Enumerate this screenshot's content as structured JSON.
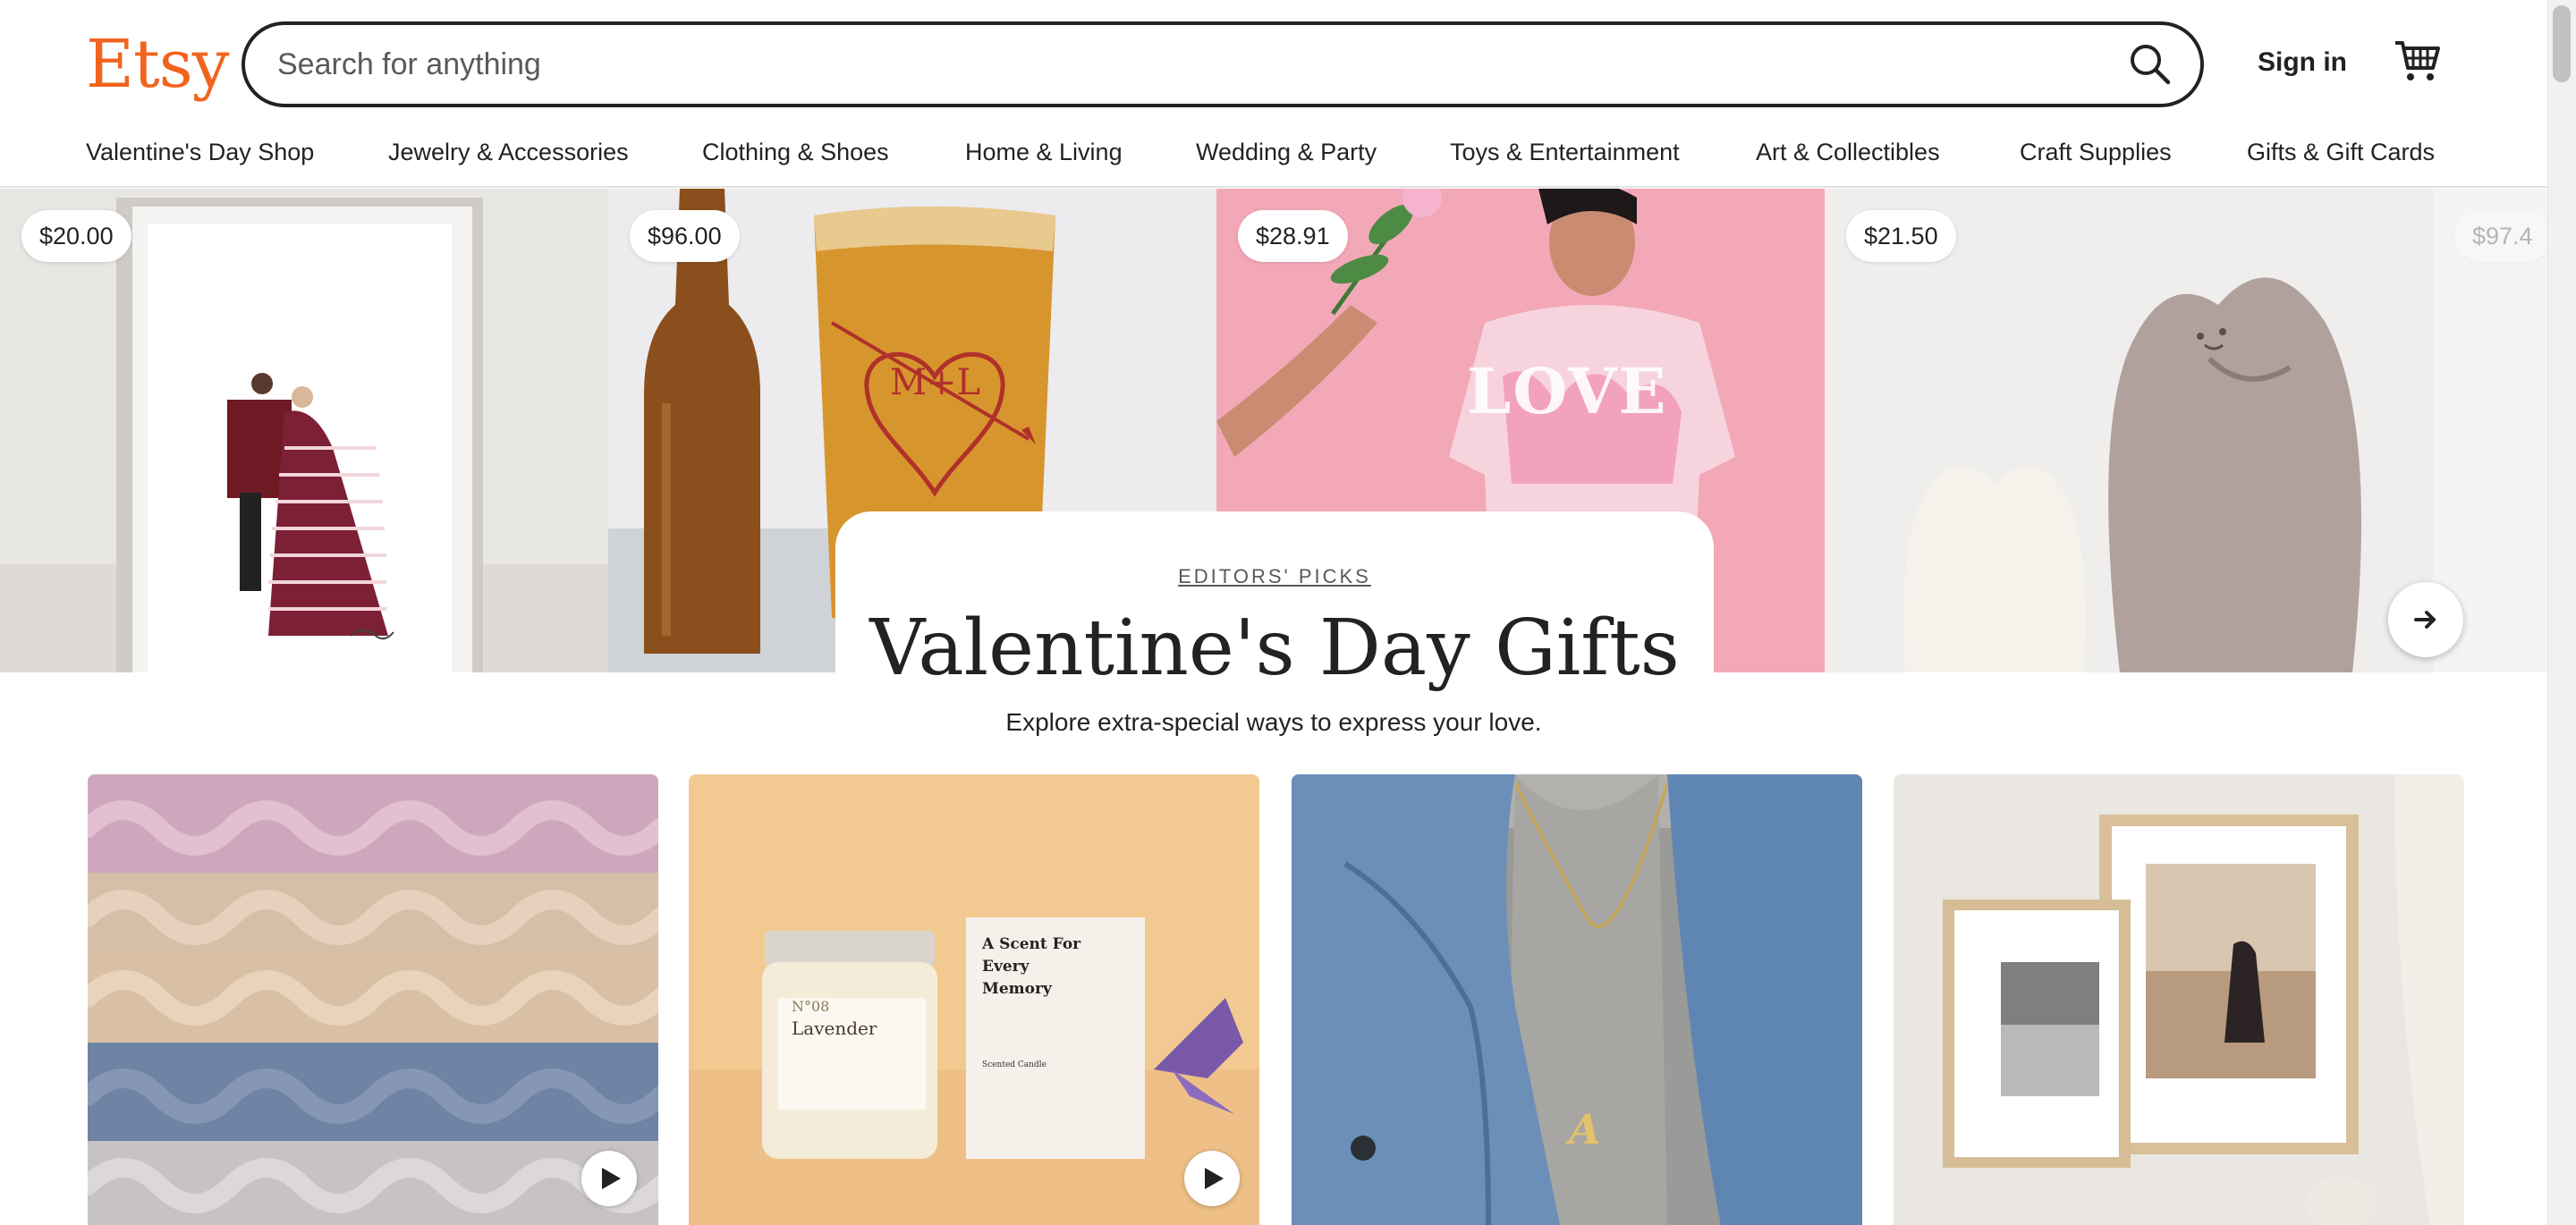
{
  "header": {
    "logo": "Etsy",
    "search_placeholder": "Search for anything",
    "sign_in": "Sign in"
  },
  "categories": [
    "Valentine's Day Shop",
    "Jewelry & Accessories",
    "Clothing & Shoes",
    "Home & Living",
    "Wedding & Party",
    "Toys & Entertainment",
    "Art & Collectibles",
    "Craft Supplies",
    "Gifts & Gift Cards"
  ],
  "hero": {
    "prices": [
      "$20.00",
      "$96.00",
      "$28.91",
      "$21.50",
      "$97.4"
    ],
    "kicker": "EDITORS' PICKS",
    "title": "Valentine's Day Gifts",
    "subtitle": "Explore extra-special ways to express your love."
  },
  "products": {
    "candle_label": "Lavender",
    "candle_number": "N°08",
    "box_text": "A Scent For Every Memory",
    "box_sub": "Scented Candle",
    "necklace_letter": "A",
    "glass_letters": "M+L"
  },
  "colors": {
    "brand": "#F1641E",
    "text": "#222222",
    "muted": "#595959"
  }
}
